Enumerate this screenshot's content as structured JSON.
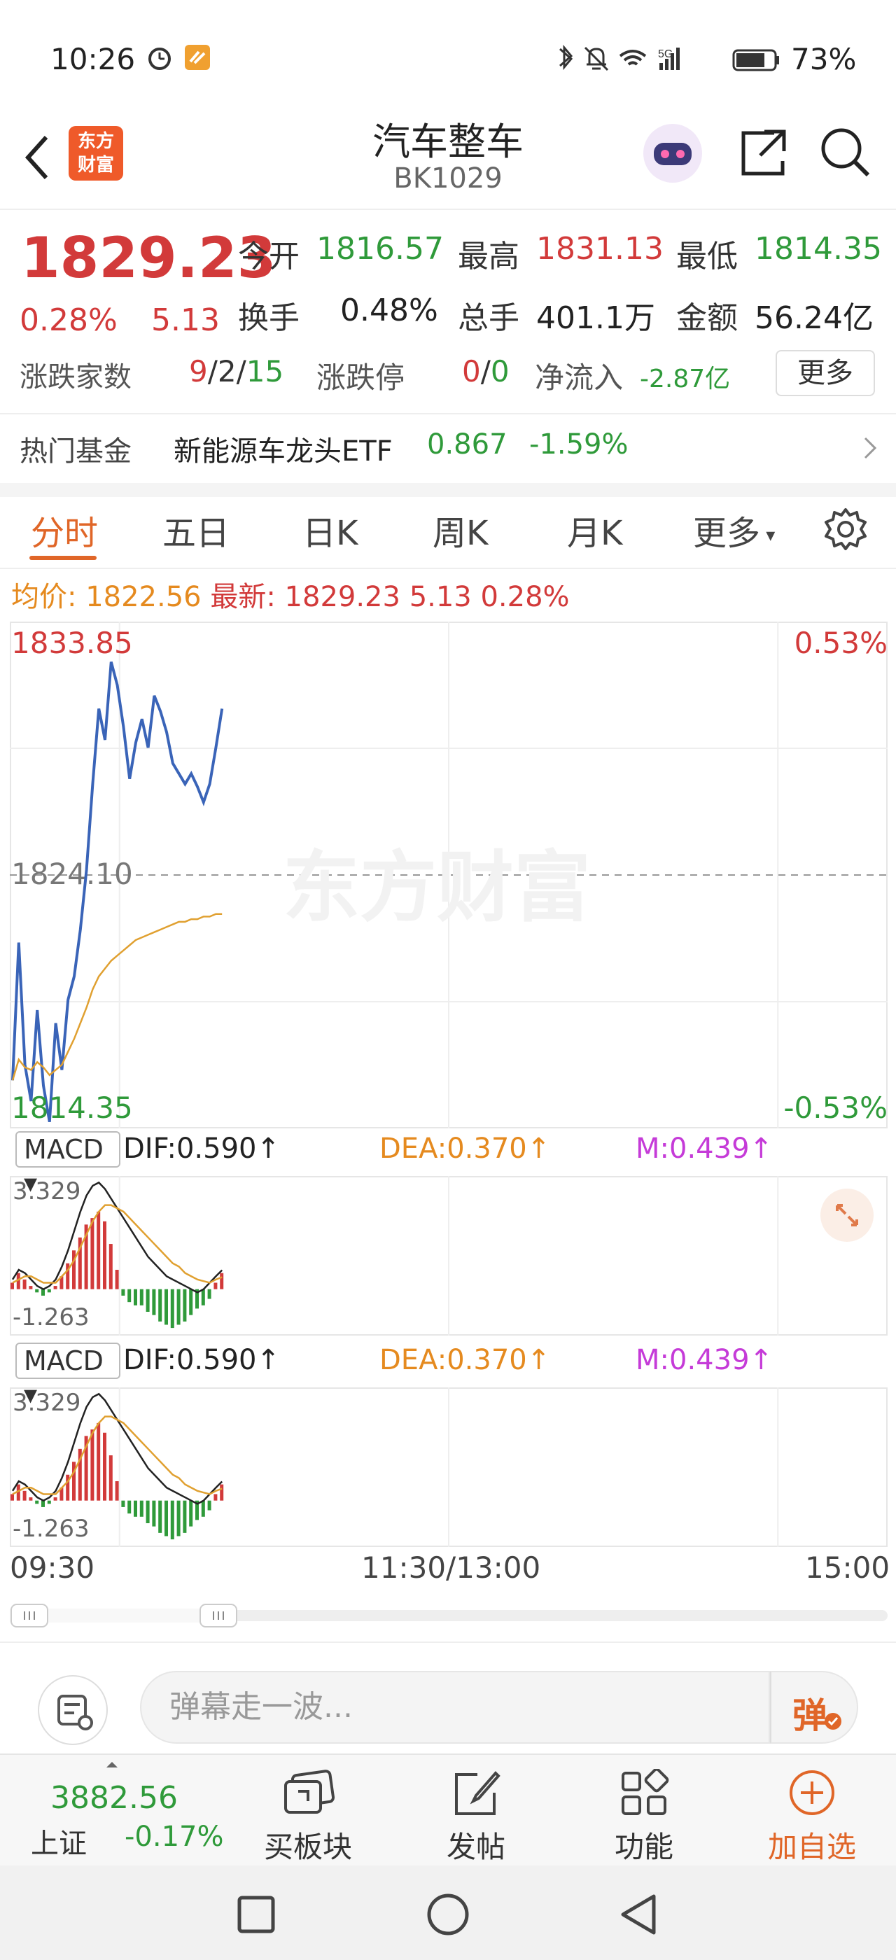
{
  "status_bar": {
    "time": "10:26",
    "battery": "73%"
  },
  "header": {
    "title": "汽车整车",
    "code": "BK1029",
    "logo_line1": "东方",
    "logo_line2": "财富"
  },
  "quote": {
    "last_price": "1829.23",
    "change_pct": "0.28%",
    "change": "5.13",
    "open_label": "今开",
    "open": "1816.57",
    "high_label": "最高",
    "high": "1831.13",
    "low_label": "最低",
    "low": "1814.35",
    "turnover_label": "换手",
    "turnover": "0.48%",
    "volume_label": "总手",
    "volume": "401.1万",
    "amount_label": "金额",
    "amount": "56.24亿",
    "adv_dec_label": "涨跌家数",
    "adv": "9",
    "flat": "2",
    "dec": "15",
    "limit_label": "涨跌停",
    "limit_up": "0",
    "limit_down": "0",
    "net_inflow_label": "净流入",
    "net_inflow": "-2.87亿",
    "more_label": "更多"
  },
  "hot_fund": {
    "label": "热门基金",
    "name": "新能源车龙头ETF",
    "price": "0.867",
    "change": "-1.59%"
  },
  "tabs": [
    "分时",
    "五日",
    "日K",
    "周K",
    "月K",
    "更多"
  ],
  "avg_bar": {
    "avg_label": "均价:",
    "avg_value": "1822.56",
    "latest_label": "最新:",
    "latest_value": "1829.23",
    "change": "5.13",
    "change_pct": "0.28%"
  },
  "watermark": "东方财富",
  "chart_data": [
    {
      "type": "line",
      "title": "",
      "ylim": [
        1814.35,
        1833.85
      ],
      "y_labels": {
        "top": "1833.85",
        "mid": "1824.10",
        "bottom": "1814.35",
        "top_pct": "0.53%",
        "bottom_pct": "-0.53%"
      },
      "x_labels": [
        "09:30",
        "11:30/13:00",
        "15:00"
      ],
      "series": [
        {
          "values": [
            1816.2,
            1821.5,
            1816.8,
            1815.4,
            1818.9,
            1816.0,
            1814.6,
            1818.4,
            1816.6,
            1819.3,
            1820.2,
            1822.0,
            1824.3,
            1827.6,
            1830.5,
            1829.3,
            1832.3,
            1831.4,
            1829.8,
            1827.8,
            1829.2,
            1830.1,
            1829.0,
            1831.0,
            1830.4,
            1829.6,
            1828.4,
            1828.0,
            1827.6,
            1828.0,
            1827.5,
            1826.9,
            1827.6,
            1829.0,
            1830.5
          ]
        },
        {
          "values": [
            1816.2,
            1817.0,
            1816.7,
            1816.6,
            1816.9,
            1816.7,
            1816.4,
            1816.6,
            1816.8,
            1817.3,
            1817.8,
            1818.4,
            1819.0,
            1819.7,
            1820.2,
            1820.5,
            1820.8,
            1821.0,
            1821.2,
            1821.4,
            1821.6,
            1821.7,
            1821.8,
            1821.9,
            1822.0,
            1822.1,
            1822.2,
            1822.3,
            1822.3,
            1822.4,
            1822.4,
            1822.5,
            1822.5,
            1822.6,
            1822.6
          ]
        }
      ]
    },
    {
      "type": "bar",
      "title": "MACD",
      "ylim": [
        -1.263,
        3.329
      ],
      "y_labels": {
        "top": "3.329",
        "bottom": "-1.263"
      },
      "dif": "0.590",
      "dea": "0.370",
      "m": "0.439",
      "hist": [
        0.2,
        0.5,
        0.3,
        0.1,
        -0.1,
        -0.2,
        -0.1,
        0.1,
        0.4,
        0.8,
        1.2,
        1.6,
        2.0,
        2.2,
        2.4,
        2.1,
        1.4,
        0.6,
        -0.2,
        -0.4,
        -0.5,
        -0.5,
        -0.7,
        -0.8,
        -1.0,
        -1.1,
        -1.2,
        -1.1,
        -1.0,
        -0.8,
        -0.6,
        -0.5,
        -0.3,
        0.2,
        0.5
      ],
      "dif_line": [
        0.3,
        0.6,
        0.5,
        0.3,
        0.1,
        0.0,
        0.1,
        0.3,
        0.7,
        1.2,
        1.8,
        2.4,
        2.9,
        3.2,
        3.3,
        3.1,
        2.8,
        2.5,
        2.2,
        1.9,
        1.6,
        1.3,
        1.0,
        0.8,
        0.6,
        0.4,
        0.3,
        0.2,
        0.1,
        0.0,
        -0.1,
        0.0,
        0.2,
        0.4,
        0.59
      ],
      "dea_line": [
        0.2,
        0.3,
        0.4,
        0.4,
        0.3,
        0.2,
        0.2,
        0.2,
        0.4,
        0.6,
        0.9,
        1.3,
        1.7,
        2.1,
        2.4,
        2.6,
        2.6,
        2.5,
        2.4,
        2.2,
        2.0,
        1.8,
        1.6,
        1.4,
        1.2,
        1.0,
        0.8,
        0.7,
        0.5,
        0.4,
        0.3,
        0.25,
        0.2,
        0.3,
        0.37
      ]
    }
  ],
  "danmu": {
    "placeholder": "弹幕走一波...",
    "btn": "弹"
  },
  "bottom_nav": {
    "index_value": "3882.56",
    "index_name": "上证",
    "index_change": "-0.17%",
    "items": [
      "买板块",
      "发帖",
      "功能",
      "加自选"
    ]
  },
  "colors": {
    "up": "#d23a3a",
    "down": "#2f9a3a",
    "accent": "#e06628",
    "price_line": "#3a64b8",
    "avg_line": "#e0a030"
  }
}
